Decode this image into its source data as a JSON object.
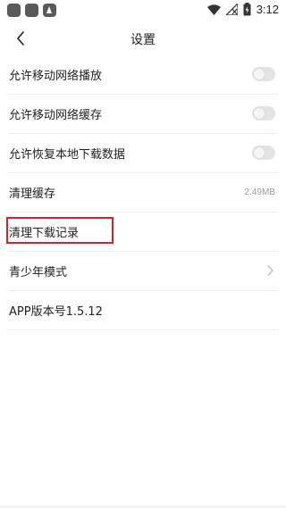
{
  "status_bar": {
    "time": "3:12",
    "icons": [
      "app-icon",
      "app-icon",
      "app-a-icon",
      "wifi-icon",
      "no-signal-icon",
      "battery-charging-icon"
    ]
  },
  "header": {
    "title": "设置",
    "back_icon": "chevron-left-icon"
  },
  "settings": {
    "mobile_play": {
      "label": "允许移动网络播放",
      "enabled": false
    },
    "mobile_cache": {
      "label": "允许移动网络缓存",
      "enabled": false
    },
    "restore_local": {
      "label": "允许恢复本地下载数据",
      "enabled": false
    },
    "clear_cache": {
      "label": "清理缓存",
      "value": "2.49MB"
    },
    "clear_downloads": {
      "label": "清理下载记录"
    },
    "teen_mode": {
      "label": "青少年模式",
      "icon": "chevron-right-icon"
    },
    "app_version": {
      "label": "APP版本号1.5.12"
    }
  },
  "colors": {
    "highlight_border": "#d6202a",
    "toggle_off": "#e3e3e3"
  }
}
